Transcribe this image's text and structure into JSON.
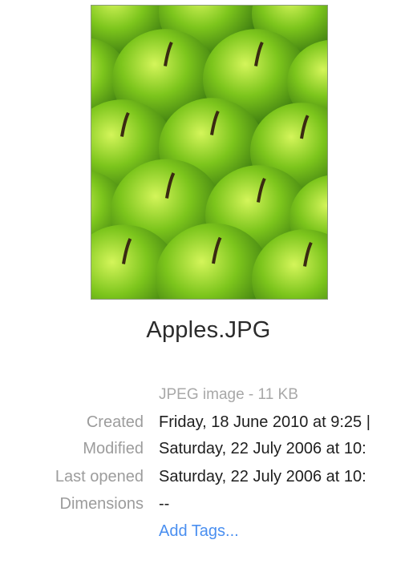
{
  "preview": {
    "image_subject": "green apples",
    "colors": {
      "apple": "#7cc51c",
      "highlight": "#c8ef4a",
      "shadow": "#2e6a0e"
    }
  },
  "file": {
    "name": "Apples.JPG",
    "kind_size": "JPEG image - 11 KB"
  },
  "info": [
    {
      "label": "Created",
      "value": "Friday, 18 June 2010 at 9:25 |"
    },
    {
      "label": "Modified",
      "value": "Saturday, 22 July 2006 at 10:"
    },
    {
      "label": "Last opened",
      "value": "Saturday, 22 July 2006 at 10:"
    },
    {
      "label": "Dimensions",
      "value": "--"
    }
  ],
  "tags": {
    "add_label": "Add Tags..."
  }
}
